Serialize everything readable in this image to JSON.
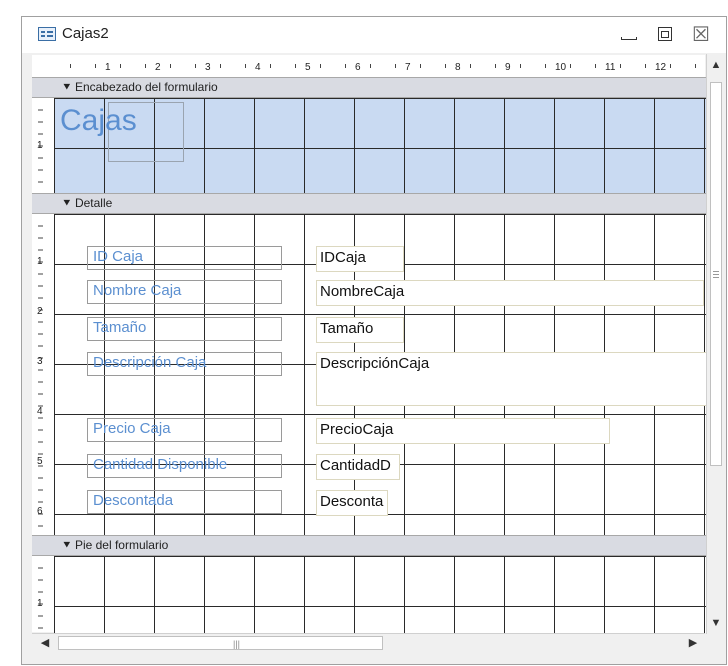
{
  "window": {
    "title": "Cajas2",
    "min_icon": "minimize-icon",
    "max_icon": "restore-icon",
    "close_icon": "close-icon",
    "close_glyph": "☒"
  },
  "ruler": {
    "numbers": [
      "1",
      "2",
      "3",
      "4",
      "5",
      "6",
      "7",
      "8",
      "9",
      "10",
      "11",
      "12"
    ],
    "vertical_numbers_header": [
      "1"
    ],
    "vertical_numbers_detail": [
      "1",
      "2",
      "3",
      "4",
      "5",
      "6"
    ],
    "vertical_numbers_footer": [
      "1"
    ]
  },
  "sections": {
    "header": {
      "label": "Encabezado del formulario",
      "title": "Cajas"
    },
    "detail": {
      "label": "Detalle"
    },
    "footer": {
      "label": "Pie del formulario"
    }
  },
  "fields": [
    {
      "label": "ID Caja",
      "control": "IDCaja"
    },
    {
      "label": "Nombre Caja",
      "control": "NombreCaja"
    },
    {
      "label": "Tamaño",
      "control": "Tamaño"
    },
    {
      "label": "Descripción Caja",
      "control": "DescripciónCaja"
    },
    {
      "label": "Precio Caja",
      "control": "PrecioCaja"
    },
    {
      "label": "Cantidad Disponible",
      "control": "CantidadD"
    },
    {
      "label": "Descontada",
      "control": "Desconta"
    }
  ],
  "colors": {
    "header_fill": "#c9daf2",
    "grid_line": "#2a2a2a",
    "label_text": "#5b8fd0",
    "section_bar": "#d9dbe2"
  }
}
